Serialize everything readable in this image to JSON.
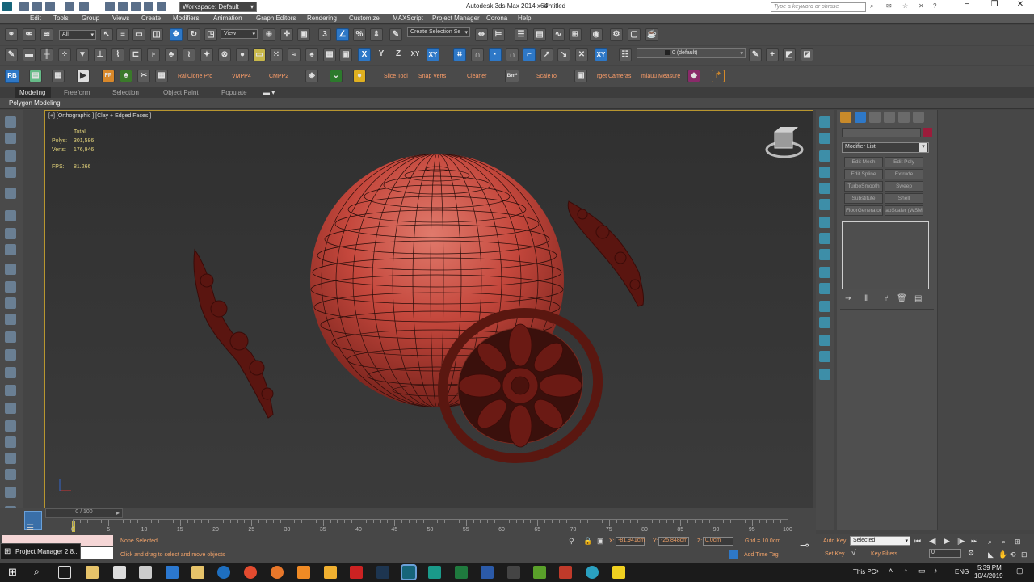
{
  "titlebar": {
    "workspace": "Workspace: Default",
    "app_title": "Autodesk 3ds Max  2014 x64",
    "doc_title": "Untitled",
    "search_placeholder": "Type a keyword or phrase"
  },
  "menu": [
    "Edit",
    "Tools",
    "Group",
    "Views",
    "Create",
    "Modifiers",
    "Animation",
    "Graph Editors",
    "Rendering",
    "Customize",
    "MAXScript",
    "Project Manager",
    "Corona",
    "Help"
  ],
  "toolbar1": {
    "filter_value": "All",
    "ref_coord": "View",
    "selection_set": "Create Selection Se"
  },
  "toolbar2": {
    "axis_x": "X",
    "axis_y": "Y",
    "axis_z": "Z",
    "axis_xy": "XY",
    "layer": "0 (default)"
  },
  "toolbar3": {
    "rb_badge": "RB",
    "fp_badge": "FP",
    "bm_badge": "Bm²",
    "labels": [
      "RailClone Pro",
      "VMPP4",
      "CMPP2",
      "Slice Tool",
      "Snap Verts",
      "Cleaner",
      "ScaleTo",
      "rget Cameras",
      "miauu Measure"
    ]
  },
  "ribbon": {
    "tabs": [
      "Modeling",
      "Freeform",
      "Selection",
      "Object Paint",
      "Populate"
    ],
    "sub": "Polygon Modeling"
  },
  "viewport": {
    "label": "[+] [Orthographic ] [Clay + Edged Faces ]",
    "total_label": "Total",
    "polys_label": "Polys:",
    "polys_value": "301,586",
    "verts_label": "Verts:",
    "verts_value": "176,946",
    "fps_label": "FPS:",
    "fps_value": "81.266"
  },
  "command_panel": {
    "modifier_list": "Modifier List",
    "buttons": [
      "Edit Mesh",
      "Edit Poly",
      "Edit Spline",
      "Extrude",
      "TurboSmooth",
      "Sweep",
      "Substitute",
      "Shell",
      "FloorGenerator",
      "apScaler (WSM"
    ]
  },
  "timeline": {
    "frame": "0 / 100",
    "ticks": [
      "0",
      "5",
      "10",
      "15",
      "20",
      "25",
      "30",
      "35",
      "40",
      "45",
      "50",
      "55",
      "60",
      "65",
      "70",
      "75",
      "80",
      "85",
      "90",
      "95",
      "100"
    ]
  },
  "status": {
    "selection": "None Selected",
    "prompt": "Click and drag to select and move objects",
    "x_label": "X:",
    "x_value": "-81.941cm",
    "y_label": "Y:",
    "y_value": "-25.848cm",
    "z_label": "Z:",
    "z_value": "0.0cm",
    "grid": "Grid = 10.0cm",
    "add_time_tag": "Add Time Tag",
    "auto_key": "Auto Key",
    "set_key": "Set Key",
    "key_mode": "Selected",
    "key_filters": "Key Filters...",
    "frame_field": "0",
    "left_panel": "Project Manager 2.8..."
  },
  "taskbar": {
    "this_pc": "This PC",
    "lang": "ENG",
    "time": "5:39 PM",
    "date": "10/4/2019"
  },
  "colors": {
    "sphere": "#c4473c",
    "ornament": "#6b1a14",
    "viewport_border": "#b8962f",
    "accent_blue": "#2e78c7"
  }
}
